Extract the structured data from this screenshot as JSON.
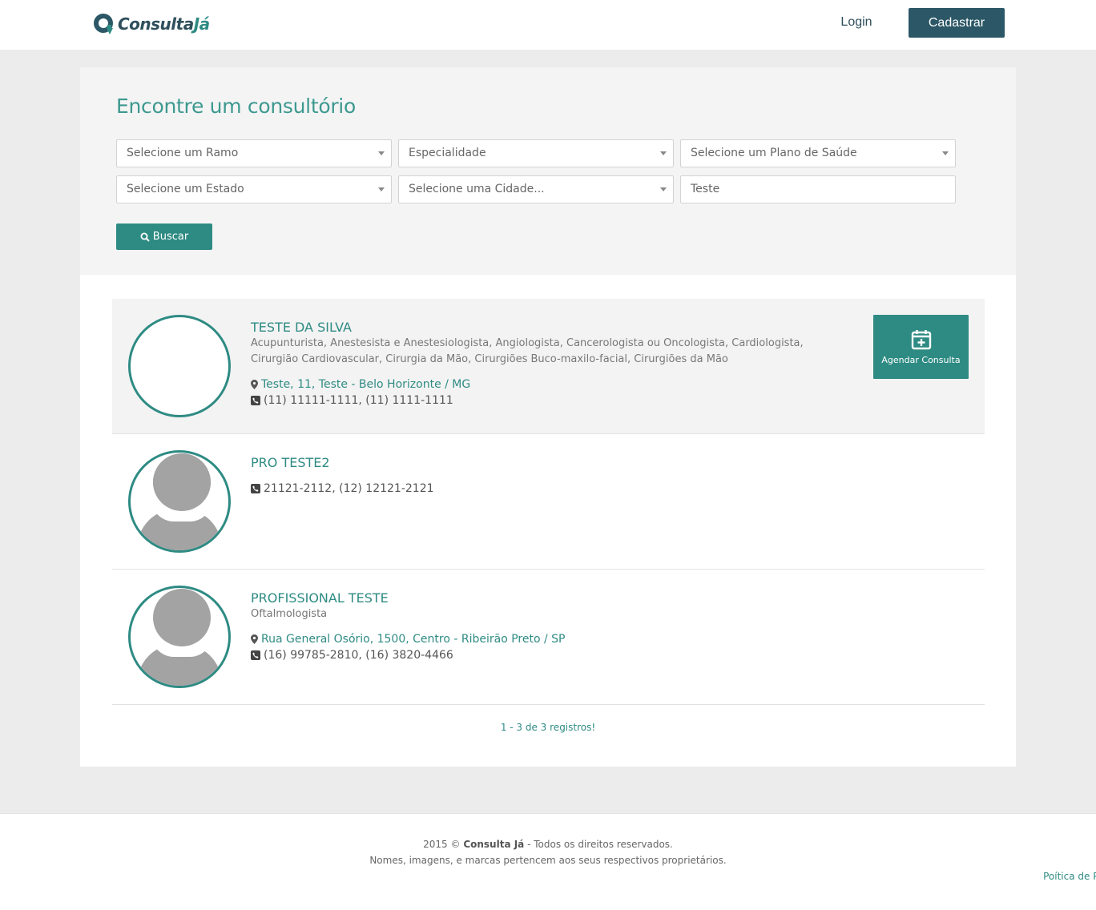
{
  "header": {
    "logo_text_main": "Consulta",
    "logo_text_accent": "Já",
    "login_label": "Login",
    "signup_label": "Cadastrar"
  },
  "search": {
    "title": "Encontre um consultório",
    "ramo": "Selecione um Ramo",
    "especialidade": "Especialidade",
    "plano": "Selecione um Plano de Saúde",
    "estado": "Selecione um Estado",
    "cidade": "Selecione uma Cidade...",
    "query_value": "Teste",
    "button_label": "Buscar"
  },
  "results": [
    {
      "name": "TESTE DA SILVA",
      "specialties": "Acupunturista, Anestesista e Anestesiologista, Angiologista, Cancerologista ou Oncologista, Cardiologista, Cirurgião Cardiovascular, Cirurgia da Mão, Cirurgiões Buco-maxilo-facial, Cirurgiões da Mão",
      "address": "Teste, 11, Teste - Belo Horizonte / MG",
      "phones": "(11) 11111-1111, (11) 1111-1111",
      "action_label": "Agendar Consulta"
    },
    {
      "name": "PRO TESTE2",
      "phones": "21121-2112, (12) 12121-2121"
    },
    {
      "name": "PROFISSIONAL TESTE",
      "specialties": "Oftalmologista",
      "address": "Rua General Osório, 1500, Centro - Ribeirão Preto / SP",
      "phones": "(16) 99785-2810, (16) 3820-4466"
    }
  ],
  "pagination": {
    "info": "1 - 3 de 3 registros!"
  },
  "footer": {
    "year": "2015 ©",
    "brand": "Consulta Já",
    "rights": "- Todos os direitos reservados.",
    "disclaimer": "Nomes, imagens, e marcas pertencem aos seus respectivos proprietários.",
    "privacy_link": "Poítica de Privacidade"
  },
  "colors": {
    "primary": "#2e8b83",
    "dark": "#2b5766",
    "panel": "#f4f4f4",
    "page_bg": "#ececec"
  }
}
